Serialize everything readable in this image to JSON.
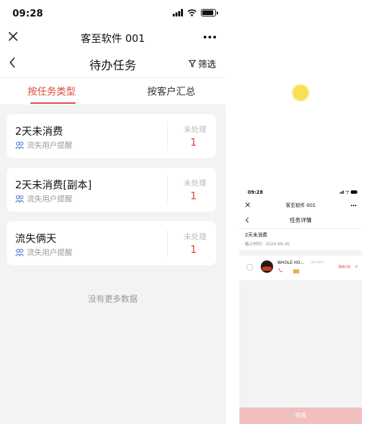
{
  "left_phone": {
    "status_time": "09:28",
    "app_title": "客至软件 001",
    "page_title": "待办任务",
    "filter_label": "筛选",
    "tabs": [
      {
        "label": "按任务类型",
        "active": true
      },
      {
        "label": "按客户汇总",
        "active": false
      }
    ],
    "cards": [
      {
        "title": "2天未消费",
        "subtitle": "流失用户提醒",
        "status": "未处理",
        "count": "1"
      },
      {
        "title": "2天未消费[副本]",
        "subtitle": "流失用户提醒",
        "status": "未处理",
        "count": "1"
      },
      {
        "title": "流失俩天",
        "subtitle": "流失用户提醒",
        "status": "未处理",
        "count": "1"
      }
    ],
    "no_more": "没有更多数据"
  },
  "right_phone": {
    "status_time": "09:28",
    "app_title": "客至软件 001",
    "page_title": "任务详情",
    "task_title": "2天未消费",
    "deadline": "截止时间：2020-06-30",
    "customer": {
      "name": "WHOLE HO...",
      "tag": "(账号880)",
      "remaining": "剩余3天"
    },
    "done_label": "完成"
  },
  "colors": {
    "accent": "#e2453c",
    "background": "#f3f3f3",
    "done_button": "#f0c0c0"
  },
  "icons": [
    "close-icon",
    "more-icon",
    "back-chevron-icon",
    "filter-icon",
    "users-icon",
    "phone-icon",
    "coupon-icon"
  ]
}
